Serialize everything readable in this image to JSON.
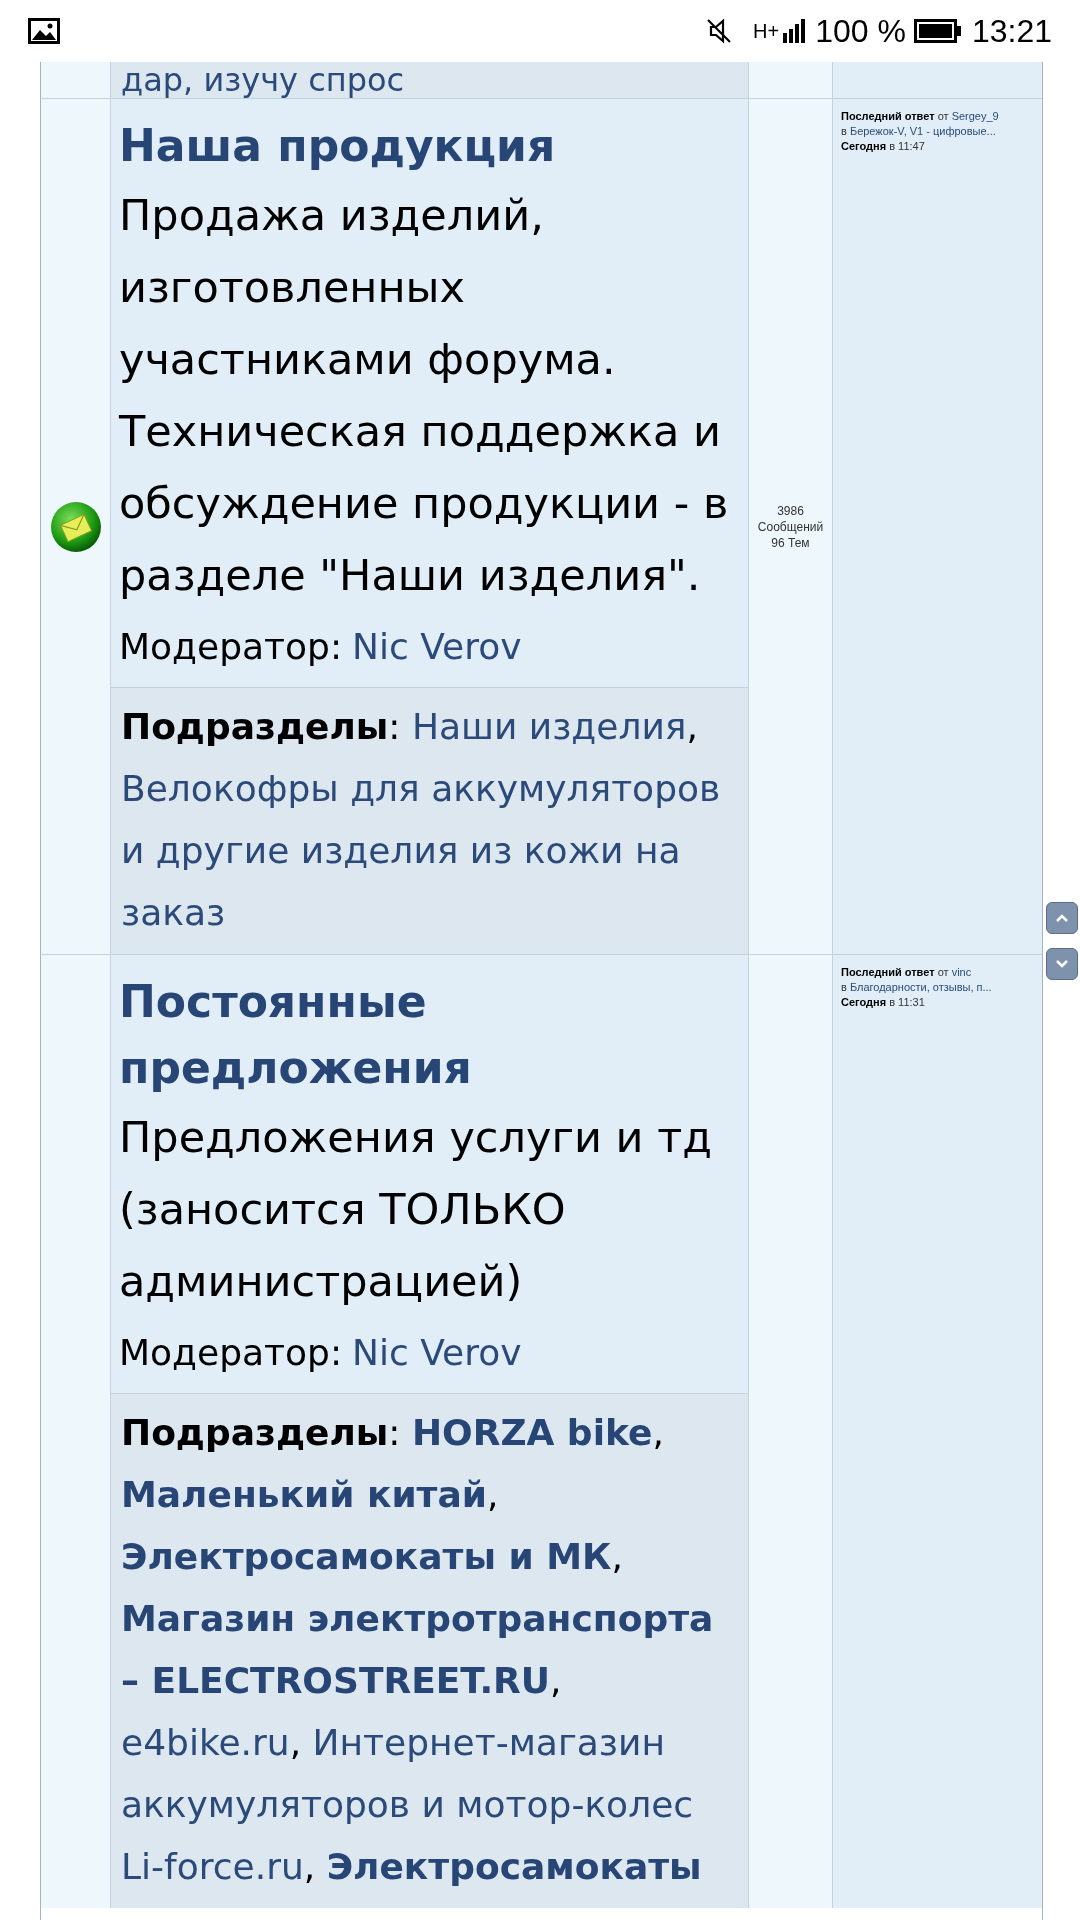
{
  "status_bar": {
    "network": "H+",
    "battery": "100 %",
    "time": "13:21"
  },
  "partial_row": {
    "subforums_tail": "дар, изучу спрос"
  },
  "forums": [
    {
      "title": "Наша продукция",
      "description": "Продажа изделий, изготовленных участниками форума. Техническая поддержка и обсуждение продукции - в разделе \"Наши изделия\".",
      "has_icon": true,
      "moderator_label": "Модератор:",
      "moderator": "Nic Verov",
      "subforums_label": "Подразделы",
      "subforums_colon": ":",
      "subforums": [
        {
          "label": "Наши изделия",
          "bold": false,
          "separator": ","
        },
        {
          "label": "Велокофры для аккумуляторов и другие изделия из кожи на заказ",
          "bold": false
        }
      ],
      "stats": [
        "3986",
        "Сообщений",
        "96 Тем"
      ],
      "last_post": {
        "label": "Последний ответ",
        "from": "от",
        "user": "Sergey_9",
        "in": "в",
        "thread": "Бережок-V, V1 - цифровые...",
        "day": "Сегодня",
        "time": "в 11:47"
      }
    },
    {
      "title": "Постоянные предложения",
      "description": "Предложения услуги и тд (заносится ТОЛЬКО администрацией)",
      "has_icon": false,
      "moderator_label": "Модератор:",
      "moderator": "Nic Verov",
      "subforums_label": "Подразделы",
      "subforums_colon": ":",
      "subforums": [
        {
          "label": "HORZA bike",
          "bold": true,
          "separator": ","
        },
        {
          "label": "Маленький китай",
          "bold": true,
          "separator": ","
        },
        {
          "label": "Электросамокаты и МК",
          "bold": true,
          "separator": ","
        },
        {
          "label": "Магазин электротранспорта – ELECTROSTREET.RU",
          "bold": true,
          "separator": ","
        },
        {
          "label": "e4bike.ru",
          "bold": false,
          "separator": ","
        },
        {
          "label": "Интернет-магазин аккумуляторов и мотор-колес Li-force.ru",
          "bold": false,
          "separator": ","
        },
        {
          "label": "Электросамокаты",
          "bold": true
        }
      ],
      "last_post": {
        "label": "Последний ответ",
        "from": "от",
        "user": "vinc",
        "in": "в",
        "thread": "Благодарности, отзывы, п...",
        "day": "Сегодня",
        "time": "в 11:31"
      }
    }
  ]
}
